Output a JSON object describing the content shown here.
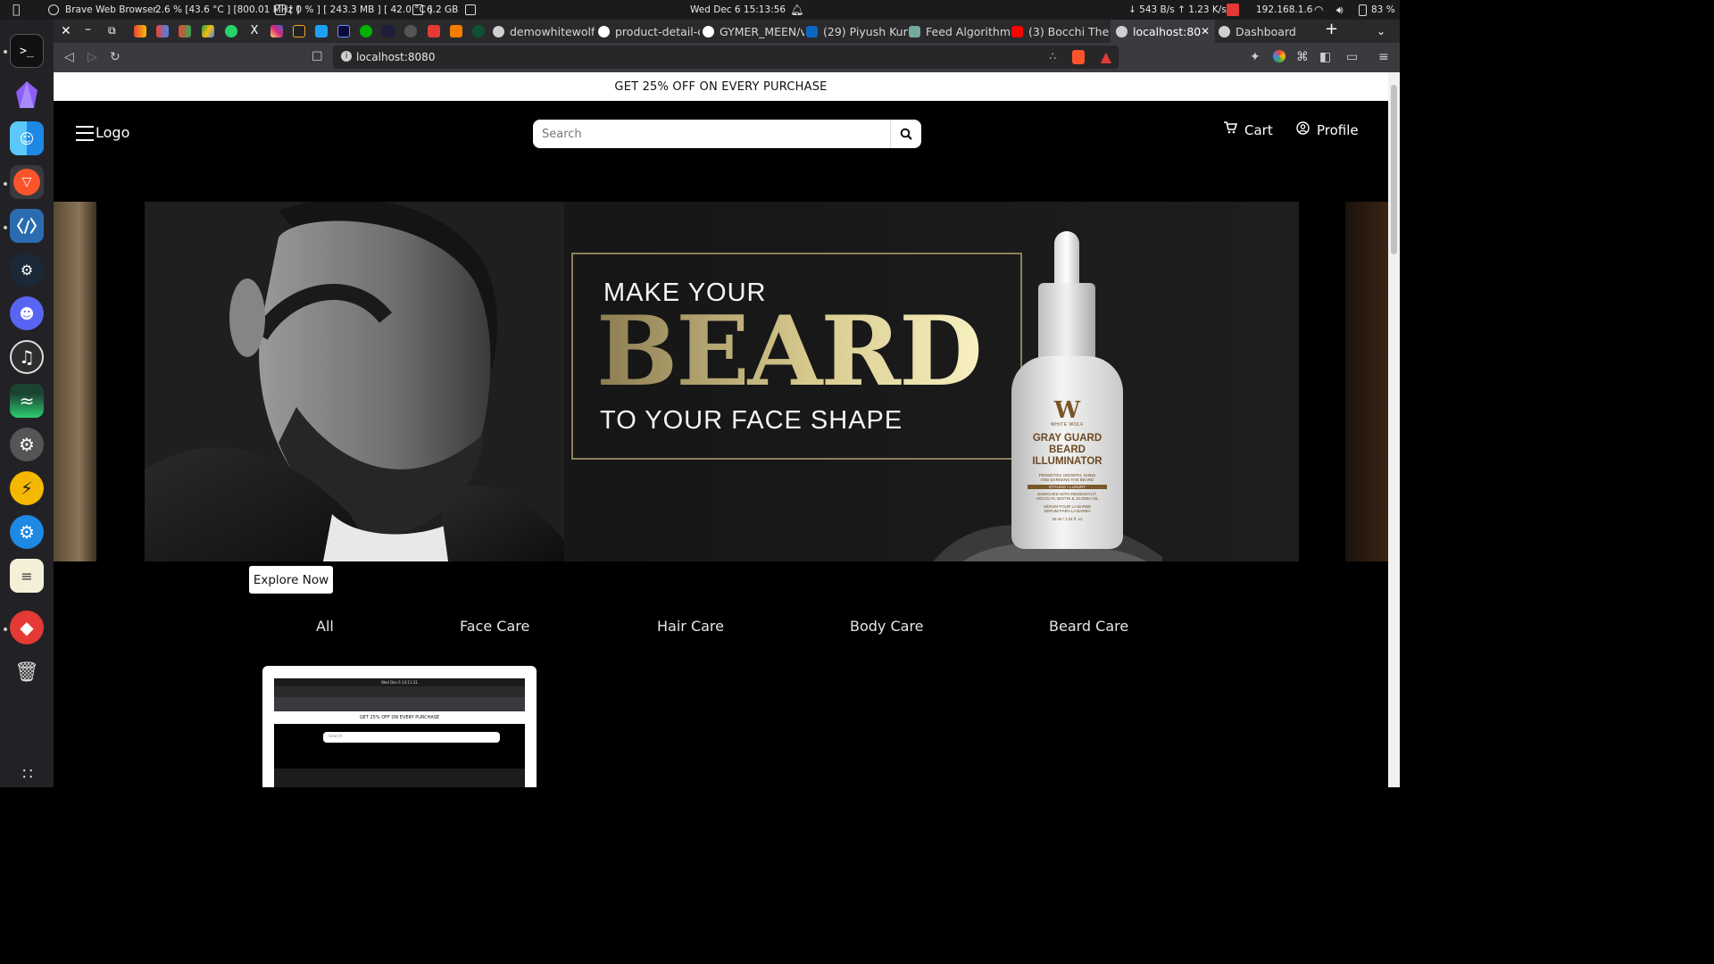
{
  "system_bar": {
    "app_name": "Brave Web Browser",
    "cpu": "2.6 % [43.6 °C ] [800.01 MHz ]",
    "gpu": "[ 0 % ] [ 243.3 MB ] [ 42.0 °C ]",
    "ram": "6.2 GB",
    "datetime": "Wed Dec 6  15:13:56",
    "network": "↓ 543 B/s ↑ 1.23 K/s",
    "ip": "192.168.1.6",
    "battery": "83 %"
  },
  "tabs": [
    {
      "label": "demowhitewolf.",
      "color": "#cfcfcf"
    },
    {
      "label": "product-detail-c",
      "color": "#ffffff"
    },
    {
      "label": "GYMER_MEEN/v",
      "color": "#ffffff"
    },
    {
      "label": "(29) Piyush Kum",
      "color": "#0a66c2"
    },
    {
      "label": "Feed Algorithm",
      "color": "#74aa9c"
    },
    {
      "label": "(3) Bocchi The F",
      "color": "#ff0000"
    },
    {
      "label": "localhost:80",
      "color": "#cfcfcf",
      "active": true
    },
    {
      "label": "Dashboard",
      "color": "#cfcfcf"
    }
  ],
  "address_bar": {
    "url": "localhost:8080"
  },
  "site": {
    "promo": "GET 25% OFF ON EVERY PURCHASE",
    "logo": "Logo",
    "search_placeholder": "Search",
    "cart": "Cart",
    "profile": "Profile",
    "hero": {
      "line1": "MAKE YOUR",
      "line2": "BEARD",
      "line3": "TO YOUR FACE SHAPE",
      "bottle": {
        "brand": "WHITE WOLF",
        "name_line1": "GRAY GUARD",
        "name_line2": "BEARD",
        "name_line3": "ILLUMINATOR",
        "desc_line1": "PROMOTES GROWTH, SHINE",
        "desc_line2": "AND DARKENS THE BEARD",
        "tag": "STYLING • LUXURY",
        "ingr_line1": "ENRICHED WITH REDENSYL®,",
        "ingr_line2": "ARCOLYS, BIOTIN & JOJOBA OIL",
        "fr_line1": "SÉRUM POUR LA BARBE",
        "fr_line2": "SÉRUM PARA LA BARBA",
        "volume": "30 ml / 1.01 fl. oz"
      }
    },
    "explore": "Explore Now",
    "categories": [
      "All",
      "Face Care",
      "Hair Care",
      "Body Care",
      "Beard Care"
    ],
    "card_preview": {
      "clock": "Wed Dec 6  14:11:31",
      "promo": "GET 25% OFF ON EVERY PURCHASE",
      "search_placeholder": "Search"
    }
  }
}
